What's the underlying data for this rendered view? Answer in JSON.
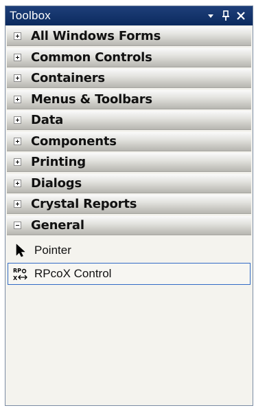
{
  "window": {
    "title": "Toolbox",
    "dropdown_icon": "dropdown-arrow-icon",
    "pin_icon": "pin-icon",
    "close_icon": "close-icon"
  },
  "categories": [
    {
      "label": "All Windows Forms",
      "expanded": false
    },
    {
      "label": "Common Controls",
      "expanded": false
    },
    {
      "label": "Containers",
      "expanded": false
    },
    {
      "label": "Menus & Toolbars",
      "expanded": false
    },
    {
      "label": "Data",
      "expanded": false
    },
    {
      "label": "Components",
      "expanded": false
    },
    {
      "label": "Printing",
      "expanded": false
    },
    {
      "label": "Dialogs",
      "expanded": false
    },
    {
      "label": "Crystal Reports",
      "expanded": false
    },
    {
      "label": "General",
      "expanded": true
    }
  ],
  "general_items": [
    {
      "label": "Pointer",
      "icon": "pointer-arrow-icon",
      "selected": false
    },
    {
      "label": "RPcoX Control",
      "icon": "rpcox-control-icon",
      "selected": true
    }
  ],
  "colors": {
    "titlebar": "#0b2a5e",
    "selection_border": "#316ac5"
  }
}
